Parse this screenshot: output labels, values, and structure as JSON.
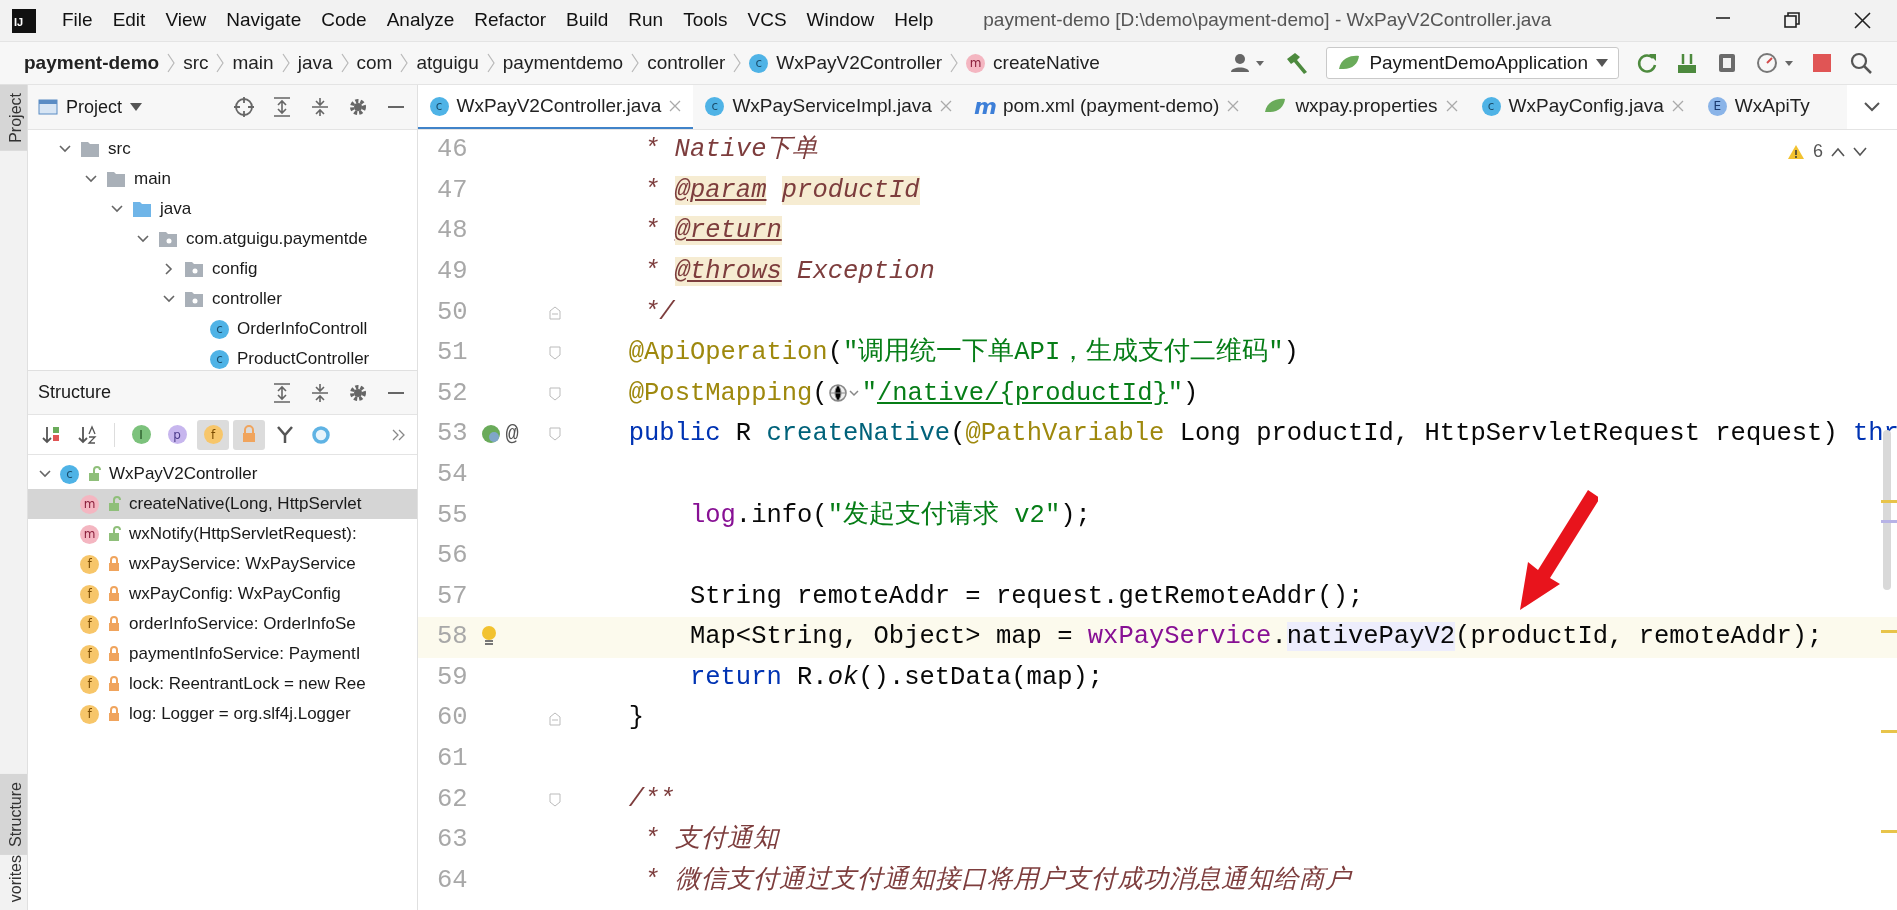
{
  "logo": "IJ",
  "menu": [
    "File",
    "Edit",
    "View",
    "Navigate",
    "Code",
    "Analyze",
    "Refactor",
    "Build",
    "Run",
    "Tools",
    "VCS",
    "Window",
    "Help"
  ],
  "title": "payment-demo [D:\\demo\\payment-demo] - WxPayV2Controller.java",
  "breadcrumbs": [
    {
      "text": "payment-demo",
      "kind": "project"
    },
    {
      "text": "src",
      "kind": "folder"
    },
    {
      "text": "main",
      "kind": "folder"
    },
    {
      "text": "java",
      "kind": "folder"
    },
    {
      "text": "com",
      "kind": "folder"
    },
    {
      "text": "atguigu",
      "kind": "folder"
    },
    {
      "text": "paymentdemo",
      "kind": "folder"
    },
    {
      "text": "controller",
      "kind": "folder"
    },
    {
      "text": "WxPayV2Controller",
      "kind": "class",
      "icon": "c"
    },
    {
      "text": "createNative",
      "kind": "method",
      "icon": "m"
    }
  ],
  "run_config": {
    "label": "PaymentDemoApplication"
  },
  "tool_stripe": {
    "top": [
      {
        "label": "Project",
        "selected": true
      }
    ],
    "bottom": [
      {
        "label": "Structure",
        "selected": true
      },
      {
        "label": "vorites",
        "selected": false
      }
    ]
  },
  "project_panel": {
    "title": "Project",
    "tree": [
      {
        "label": "src",
        "kind": "folder",
        "expanded": true,
        "children": [
          {
            "label": "main",
            "kind": "folder",
            "expanded": true,
            "children": [
              {
                "label": "java",
                "kind": "source",
                "expanded": true,
                "children": [
                  {
                    "label": "com.atguigu.paymentde",
                    "kind": "package",
                    "expanded": true,
                    "children": [
                      {
                        "label": "config",
                        "kind": "package",
                        "expanded": false
                      },
                      {
                        "label": "controller",
                        "kind": "package",
                        "expanded": true,
                        "children": [
                          {
                            "label": "OrderInfoControll",
                            "kind": "class",
                            "icon": "c"
                          },
                          {
                            "label": "ProductController",
                            "kind": "class",
                            "icon": "c"
                          }
                        ]
                      }
                    ]
                  }
                ]
              }
            ]
          }
        ]
      }
    ]
  },
  "structure_panel": {
    "title": "Structure",
    "toolbar": [
      {
        "kind": "sort-visibility",
        "selected": false
      },
      {
        "kind": "sort-alpha",
        "selected": false
      },
      {
        "kind": "inherited",
        "icon": "I",
        "selected": false
      },
      {
        "kind": "properties",
        "icon": "p",
        "selected": false
      },
      {
        "kind": "fields",
        "icon": "f",
        "selected": true
      },
      {
        "kind": "non-public",
        "selected": true
      },
      {
        "kind": "lambdas",
        "selected": false
      },
      {
        "kind": "anonymous",
        "selected": false
      }
    ],
    "root": {
      "label": "WxPayV2Controller",
      "icon": "c",
      "kind": "class",
      "expanded": true,
      "children": [
        {
          "label": "createNative(Long, HttpServlet",
          "icon": "m",
          "kind": "public-method",
          "selected": true
        },
        {
          "label": "wxNotify(HttpServletRequest):",
          "icon": "m",
          "kind": "public-method",
          "selected": false
        },
        {
          "label": "wxPayService: WxPayService",
          "icon": "f",
          "kind": "private-field",
          "selected": false
        },
        {
          "label": "wxPayConfig: WxPayConfig",
          "icon": "f",
          "kind": "private-field",
          "selected": false
        },
        {
          "label": "orderInfoService: OrderInfoSe",
          "icon": "f",
          "kind": "private-field",
          "selected": false
        },
        {
          "label": "paymentInfoService: PaymentI",
          "icon": "f",
          "kind": "private-field",
          "selected": false
        },
        {
          "label": "lock: ReentrantLock = new Ree",
          "icon": "f",
          "kind": "private-final-field",
          "selected": false
        },
        {
          "label": "log: Logger = org.slf4j.Logger",
          "icon": "f",
          "kind": "private-static-field",
          "selected": false
        }
      ]
    }
  },
  "editor_tabs": [
    {
      "label": "WxPayV2Controller.java",
      "kind": "class",
      "icon": "c",
      "selected": true
    },
    {
      "label": "WxPayServiceImpl.java",
      "kind": "class",
      "icon": "c",
      "selected": false
    },
    {
      "label": "pom.xml (payment-demo)",
      "kind": "maven",
      "icon": "m",
      "selected": false
    },
    {
      "label": "wxpay.properties",
      "kind": "properties",
      "selected": false
    },
    {
      "label": "WxPayConfig.java",
      "kind": "class",
      "icon": "c",
      "selected": false
    },
    {
      "label": "WxApiTy",
      "kind": "enum",
      "icon": "E",
      "selected": false
    }
  ],
  "inspection": {
    "count": "6"
  },
  "code_lines": [
    {
      "number": "46",
      "current": false,
      "tokens": [
        {
          "kind": "comment",
          "text": "     * Native下单"
        }
      ]
    },
    {
      "number": "47",
      "current": false,
      "tokens": [
        {
          "kind": "comment",
          "text": "     *"
        },
        {
          "kind": "doctag",
          "text": " @param"
        },
        {
          "kind": "docparam",
          "text": " productId"
        }
      ]
    },
    {
      "number": "48",
      "current": false,
      "tokens": [
        {
          "kind": "comment",
          "text": "     *"
        },
        {
          "kind": "doctag",
          "text": " @return"
        }
      ]
    },
    {
      "number": "49",
      "current": false,
      "tokens": [
        {
          "kind": "comment",
          "text": "     *"
        },
        {
          "kind": "doctag",
          "text": " @throws"
        },
        {
          "kind": "comment",
          "text": " Exception"
        }
      ]
    },
    {
      "number": "50",
      "current": false,
      "fold_end": true,
      "tokens": [
        {
          "kind": "comment",
          "text": "     */"
        }
      ]
    },
    {
      "number": "51",
      "current": false,
      "fold_start": true,
      "tokens": [
        {
          "kind": "annotation",
          "text": "    @ApiOperation"
        },
        {
          "kind": "plain",
          "text": "("
        },
        {
          "kind": "string",
          "text": "\"调用统一下单API，生成支付二维码\""
        },
        {
          "kind": "plain",
          "text": ")"
        }
      ]
    },
    {
      "number": "52",
      "current": false,
      "fold_start": true,
      "tokens": [
        {
          "kind": "annotation",
          "text": "    @PostMapping"
        },
        {
          "kind": "plain",
          "text": "("
        },
        {
          "kind": "inlay"
        },
        {
          "kind": "string",
          "text": "\""
        },
        {
          "kind": "url",
          "text": "/native/{productId}"
        },
        {
          "kind": "string",
          "text": "\""
        },
        {
          "kind": "plain",
          "text": ")"
        }
      ]
    },
    {
      "number": "53",
      "current": false,
      "fold_start": true,
      "gutter": [
        {
          "kind": "bean"
        },
        {
          "kind": "symbol",
          "text": "@"
        }
      ],
      "tokens": [
        {
          "kind": "keyword",
          "text": "    public"
        },
        {
          "kind": "plain",
          "text": " R"
        },
        {
          "kind": "declaration",
          "text": " createNative"
        },
        {
          "kind": "plain",
          "text": "("
        },
        {
          "kind": "annotation",
          "text": "@PathVariable"
        },
        {
          "kind": "plain",
          "text": " Long productId, HttpServletRequest request)"
        },
        {
          "kind": "keyword",
          "text": " thr"
        }
      ]
    },
    {
      "number": "54",
      "current": false
    },
    {
      "number": "55",
      "current": false,
      "tokens": [
        {
          "kind": "field",
          "text": "        log"
        },
        {
          "kind": "plain",
          "text": ".info("
        },
        {
          "kind": "string",
          "text": "\"发起支付请求 v2\""
        },
        {
          "kind": "plain",
          "text": ");"
        }
      ]
    },
    {
      "number": "56",
      "current": false
    },
    {
      "number": "57",
      "current": false,
      "tokens": [
        {
          "kind": "plain",
          "text": "        String remoteAddr = request.getRemoteAddr();"
        }
      ]
    },
    {
      "number": "58",
      "current": true,
      "gutter": [
        {
          "kind": "bulb"
        }
      ],
      "tokens": [
        {
          "kind": "plain",
          "text": "        Map<String, Object> map ="
        },
        {
          "kind": "field",
          "text": " wxPayService"
        },
        {
          "kind": "plain",
          "text": "."
        },
        {
          "kind": "highlight",
          "text": "nativePayV2"
        },
        {
          "kind": "plain",
          "text": "(productId, remoteAddr);"
        }
      ]
    },
    {
      "number": "59",
      "current": false,
      "tokens": [
        {
          "kind": "keyword",
          "text": "        return"
        },
        {
          "kind": "plain",
          "text": " R."
        },
        {
          "kind": "static",
          "text": "ok"
        },
        {
          "kind": "plain",
          "text": "().setData(map);"
        }
      ]
    },
    {
      "number": "60",
      "current": false,
      "fold_end": true,
      "tokens": [
        {
          "kind": "plain",
          "text": "    }"
        }
      ]
    },
    {
      "number": "61",
      "current": false
    },
    {
      "number": "62",
      "current": false,
      "fold_start": true,
      "tokens": [
        {
          "kind": "comment",
          "text": "    /**"
        }
      ]
    },
    {
      "number": "63",
      "current": false,
      "tokens": [
        {
          "kind": "comment",
          "text": "     * 支付通知"
        }
      ]
    },
    {
      "number": "64",
      "current": false,
      "tokens": [
        {
          "kind": "comment",
          "text": "     * 微信支付通过支付通知接口将用户支付成功消息通知给商户"
        }
      ]
    }
  ]
}
